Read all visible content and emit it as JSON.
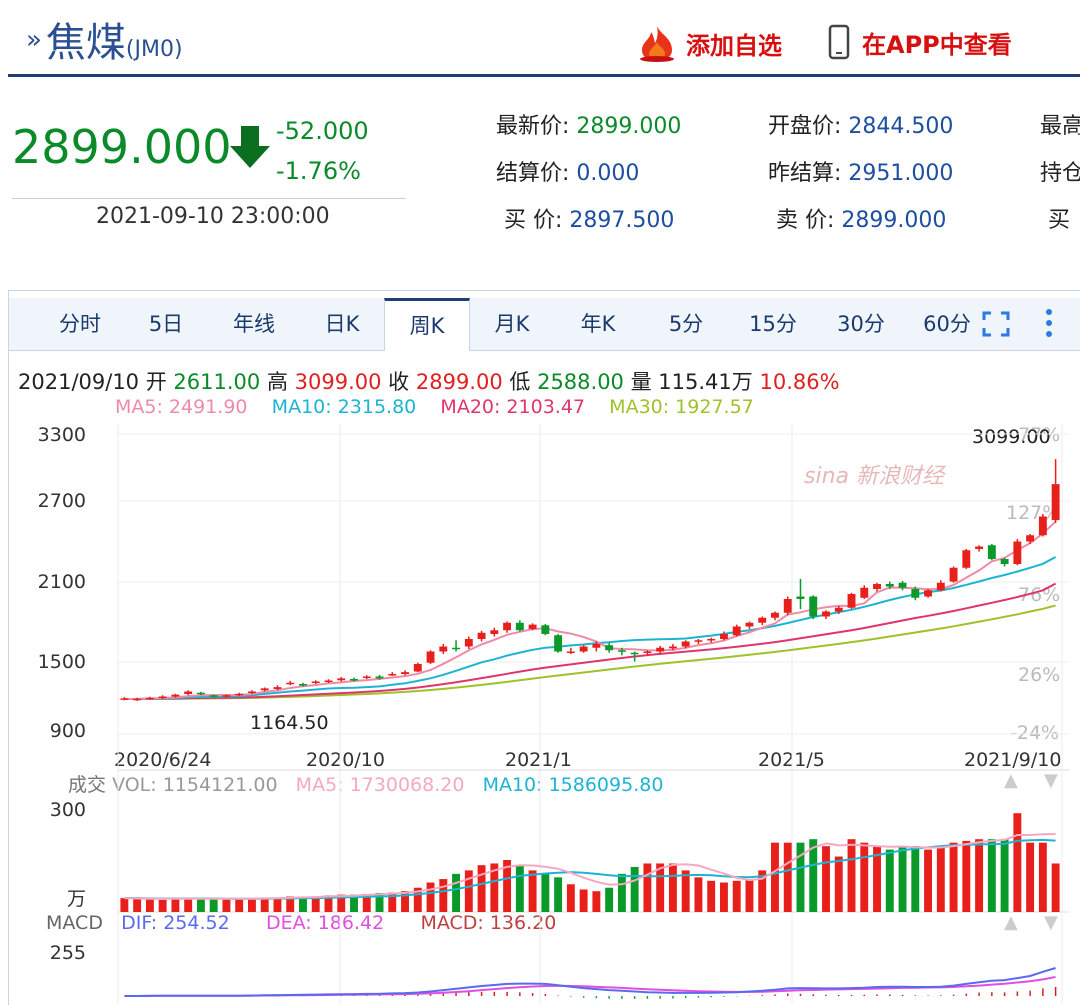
{
  "header": {
    "title": "焦煤",
    "code": "(JM0)",
    "add_watch": "添加自选",
    "view_app": "在APP中查看"
  },
  "quote": {
    "price": "2899.000",
    "change": "-52.000",
    "change_pct": "-1.76%",
    "time": "2021-09-10 23:00:00",
    "fields": {
      "latest_label": "最新价:",
      "latest": "2899.000",
      "open_label": "开盘价:",
      "open": "2844.500",
      "high_label": "最高",
      "settle_label": "结算价:",
      "settle": "0.000",
      "prev_settle_label": "昨结算:",
      "prev_settle": "2951.000",
      "oi_label": "持仓",
      "bid_label": "买  价:",
      "bid": "2897.500",
      "ask_label": "卖  价:",
      "ask": "2899.000",
      "bid2_label": "买"
    }
  },
  "tabs": [
    "分时",
    "5日",
    "年线",
    "日K",
    "周K",
    "月K",
    "年K",
    "5分",
    "15分",
    "30分",
    "60分"
  ],
  "active_tab": "周K",
  "kline_info": {
    "date": "2021/09/10",
    "open_label": "开",
    "open": "2611.00",
    "high_label": "高",
    "high": "3099.00",
    "close_label": "收",
    "close": "2899.00",
    "low_label": "低",
    "low": "2588.00",
    "vol_label": "量",
    "vol": "115.41万",
    "amp": "10.86%"
  },
  "ma": {
    "ma5": "MA5: 2491.90",
    "ma10": "MA10: 2315.80",
    "ma20": "MA20: 2103.47",
    "ma30": "MA30: 1927.57",
    "ma5_color": "#f08aa8",
    "ma10_color": "#1db4d4",
    "ma20_color": "#e0356c",
    "ma30_color": "#9ec22a"
  },
  "volume": {
    "label": "成交",
    "vol": "VOL: 1154121.00",
    "ma5": "MA5: 1730068.20",
    "ma10": "MA10: 1586095.80",
    "ytick": "300",
    "unit": "万"
  },
  "macd": {
    "label": "MACD",
    "dif": "DIF: 254.52",
    "dea": "DEA: 186.42",
    "macd": "MACD: 136.20",
    "ytick": "255"
  },
  "watermark": "sina 新浪财经",
  "chart_data": {
    "type": "candlestick",
    "y_ticks": [
      "3300",
      "2700",
      "2100",
      "1500",
      "900"
    ],
    "ylim": [
      900,
      3300
    ],
    "x_ticks": [
      "2020/6/24",
      "2020/10",
      "2021/1",
      "2021/5",
      "2021/9/10"
    ],
    "pct_ticks": [
      "77%",
      "127%",
      "76%",
      "26%",
      "-24%"
    ],
    "max_label": "3099.00",
    "min_label": "1164.50",
    "candles": [
      [
        1180,
        1185,
        1170,
        1195
      ],
      [
        1178,
        1182,
        1165,
        1190
      ],
      [
        1182,
        1190,
        1175,
        1198
      ],
      [
        1188,
        1200,
        1180,
        1210
      ],
      [
        1200,
        1215,
        1192,
        1222
      ],
      [
        1220,
        1240,
        1210,
        1250
      ],
      [
        1230,
        1218,
        1212,
        1238
      ],
      [
        1210,
        1198,
        1190,
        1215
      ],
      [
        1200,
        1210,
        1192,
        1216
      ],
      [
        1210,
        1222,
        1204,
        1230
      ],
      [
        1228,
        1240,
        1220,
        1250
      ],
      [
        1250,
        1265,
        1240,
        1272
      ],
      [
        1260,
        1275,
        1250,
        1290
      ],
      [
        1300,
        1310,
        1290,
        1325
      ],
      [
        1300,
        1290,
        1280,
        1310
      ],
      [
        1310,
        1320,
        1300,
        1330
      ],
      [
        1318,
        1328,
        1308,
        1338
      ],
      [
        1330,
        1345,
        1320,
        1355
      ],
      [
        1340,
        1330,
        1320,
        1352
      ],
      [
        1355,
        1360,
        1340,
        1370
      ],
      [
        1360,
        1345,
        1335,
        1372
      ],
      [
        1380,
        1380,
        1365,
        1395
      ],
      [
        1380,
        1395,
        1370,
        1410
      ],
      [
        1400,
        1460,
        1395,
        1470
      ],
      [
        1470,
        1560,
        1460,
        1570
      ],
      [
        1560,
        1600,
        1540,
        1620
      ],
      [
        1590,
        1580,
        1560,
        1650
      ],
      [
        1600,
        1660,
        1580,
        1680
      ],
      [
        1660,
        1710,
        1640,
        1725
      ],
      [
        1700,
        1730,
        1680,
        1750
      ],
      [
        1730,
        1790,
        1710,
        1800
      ],
      [
        1790,
        1730,
        1720,
        1810
      ],
      [
        1740,
        1775,
        1730,
        1785
      ],
      [
        1770,
        1700,
        1690,
        1780
      ],
      [
        1690,
        1560,
        1550,
        1700
      ],
      [
        1560,
        1560,
        1540,
        1590
      ],
      [
        1560,
        1600,
        1550,
        1610
      ],
      [
        1590,
        1620,
        1560,
        1640
      ],
      [
        1610,
        1570,
        1550,
        1630
      ],
      [
        1570,
        1560,
        1530,
        1590
      ],
      [
        1550,
        1545,
        1480,
        1560
      ],
      [
        1550,
        1560,
        1530,
        1570
      ],
      [
        1560,
        1590,
        1540,
        1605
      ],
      [
        1585,
        1600,
        1570,
        1620
      ],
      [
        1600,
        1640,
        1585,
        1650
      ],
      [
        1640,
        1650,
        1620,
        1660
      ],
      [
        1650,
        1660,
        1630,
        1670
      ],
      [
        1660,
        1700,
        1650,
        1720
      ],
      [
        1690,
        1760,
        1680,
        1775
      ],
      [
        1760,
        1790,
        1740,
        1800
      ],
      [
        1790,
        1830,
        1770,
        1840
      ],
      [
        1830,
        1870,
        1810,
        1880
      ],
      [
        1870,
        1980,
        1850,
        2000
      ],
      [
        2000,
        1980,
        1900,
        2140
      ],
      [
        2000,
        1840,
        1820,
        2010
      ],
      [
        1840,
        1880,
        1820,
        1890
      ],
      [
        1880,
        1910,
        1860,
        1925
      ],
      [
        1910,
        2020,
        1900,
        2030
      ],
      [
        1990,
        2070,
        1980,
        2090
      ],
      [
        2060,
        2100,
        2040,
        2110
      ],
      [
        2100,
        2080,
        2060,
        2120
      ],
      [
        2110,
        2070,
        2050,
        2125
      ],
      [
        2060,
        1990,
        1970,
        2080
      ],
      [
        2000,
        2050,
        1990,
        2060
      ],
      [
        2050,
        2110,
        2040,
        2130
      ],
      [
        2120,
        2230,
        2110,
        2240
      ],
      [
        2230,
        2370,
        2220,
        2380
      ],
      [
        2380,
        2400,
        2360,
        2410
      ],
      [
        2410,
        2300,
        2290,
        2420
      ],
      [
        2300,
        2260,
        2240,
        2310
      ],
      [
        2260,
        2440,
        2250,
        2460
      ],
      [
        2440,
        2490,
        2420,
        2500
      ],
      [
        2490,
        2640,
        2480,
        2660
      ],
      [
        2611,
        2899,
        2588,
        3099
      ]
    ],
    "ma5": [
      1180,
      1181,
      1184,
      1188,
      1193,
      1203,
      1210,
      1211,
      1212,
      1212,
      1220,
      1237,
      1249,
      1268,
      1282,
      1292,
      1305,
      1313,
      1324,
      1331,
      1341,
      1352,
      1363,
      1382,
      1412,
      1462,
      1514,
      1569,
      1617,
      1654,
      1694,
      1718,
      1739,
      1746,
      1720,
      1703,
      1676,
      1639,
      1586,
      1580,
      1578,
      1570,
      1569,
      1573,
      1590,
      1611,
      1626,
      1648,
      1684,
      1714,
      1750,
      1785,
      1856,
      1874,
      1898,
      1914,
      1926,
      1924,
      1946,
      2034,
      2072,
      2070,
      2066,
      2058,
      2060,
      2092,
      2151,
      2209,
      2281,
      2310,
      2371,
      2427,
      2504,
      2600
    ],
    "ma10": [
      1180,
      1180,
      1182,
      1184,
      1187,
      1193,
      1196,
      1198,
      1200,
      1202,
      1210,
      1221,
      1230,
      1240,
      1247,
      1256,
      1264,
      1268,
      1270,
      1275,
      1281,
      1294,
      1306,
      1325,
      1346,
      1374,
      1406,
      1439,
      1474,
      1498,
      1527,
      1551,
      1574,
      1590,
      1598,
      1609,
      1616,
      1627,
      1634,
      1644,
      1651,
      1655,
      1658,
      1660,
      1664,
      1676,
      1687,
      1701,
      1717,
      1730,
      1746,
      1765,
      1788,
      1812,
      1836,
      1855,
      1875,
      1894,
      1918,
      1944,
      1972,
      1996,
      2017,
      2035,
      2048,
      2068,
      2094,
      2120,
      2148,
      2172,
      2200,
      2230,
      2262,
      2316
    ],
    "ma20": [
      1180,
      1180,
      1181,
      1182,
      1183,
      1186,
      1188,
      1189,
      1190,
      1191,
      1194,
      1198,
      1202,
      1207,
      1212,
      1217,
      1222,
      1227,
      1232,
      1238,
      1244,
      1252,
      1261,
      1272,
      1285,
      1299,
      1314,
      1330,
      1347,
      1364,
      1382,
      1399,
      1416,
      1431,
      1444,
      1457,
      1470,
      1483,
      1496,
      1508,
      1520,
      1531,
      1541,
      1550,
      1559,
      1568,
      1577,
      1587,
      1598,
      1610,
      1622,
      1635,
      1650,
      1666,
      1682,
      1698,
      1714,
      1730,
      1748,
      1768,
      1788,
      1808,
      1828,
      1846,
      1864,
      1884,
      1906,
      1928,
      1950,
      1972,
      1996,
      2022,
      2050,
      2103
    ],
    "ma30": [
      1180,
      1180,
      1181,
      1181,
      1182,
      1183,
      1184,
      1185,
      1186,
      1187,
      1189,
      1191,
      1194,
      1197,
      1200,
      1204,
      1208,
      1212,
      1216,
      1220,
      1225,
      1231,
      1237,
      1244,
      1252,
      1261,
      1271,
      1282,
      1293,
      1305,
      1317,
      1330,
      1343,
      1356,
      1368,
      1380,
      1392,
      1404,
      1416,
      1428,
      1440,
      1451,
      1462,
      1472,
      1482,
      1492,
      1502,
      1512,
      1523,
      1534,
      1545,
      1557,
      1569,
      1582,
      1595,
      1608,
      1621,
      1635,
      1649,
      1664,
      1680,
      1696,
      1712,
      1728,
      1744,
      1762,
      1780,
      1799,
      1818,
      1838,
      1858,
      1880,
      1902,
      1928
    ],
    "volume": {
      "ylim": [
        0,
        300
      ],
      "values": [
        40,
        38,
        36,
        35,
        38,
        40,
        38,
        36,
        38,
        40,
        38,
        42,
        40,
        45,
        43,
        45,
        48,
        50,
        50,
        52,
        55,
        56,
        60,
        70,
        85,
        95,
        110,
        120,
        135,
        140,
        150,
        135,
        120,
        110,
        100,
        80,
        65,
        60,
        70,
        110,
        130,
        140,
        140,
        140,
        120,
        100,
        90,
        85,
        90,
        95,
        120,
        200,
        200,
        200,
        210,
        190,
        160,
        210,
        200,
        190,
        180,
        190,
        190,
        180,
        190,
        200,
        205,
        210,
        210,
        210,
        285,
        200,
        200,
        140
      ],
      "ma5": [
        40,
        39,
        38,
        38,
        38,
        38,
        38,
        38,
        38,
        38,
        38,
        39,
        40,
        41,
        42,
        43,
        45,
        46,
        47,
        49,
        51,
        53,
        55,
        59,
        65,
        73,
        84,
        96,
        108,
        120,
        130,
        135,
        134,
        130,
        125,
        113,
        99,
        87,
        79,
        80,
        91,
        108,
        126,
        136,
        138,
        134,
        122,
        111,
        99,
        92,
        96,
        118,
        141,
        163,
        186,
        198,
        192,
        194,
        192,
        190,
        188,
        189,
        187,
        186,
        186,
        190,
        196,
        201,
        205,
        208,
        222,
        222,
        224,
        225
      ],
      "ma10": [
        40,
        40,
        39,
        39,
        39,
        39,
        39,
        39,
        38,
        38,
        38,
        38,
        39,
        39,
        40,
        40,
        41,
        42,
        43,
        44,
        45,
        46,
        48,
        51,
        55,
        60,
        66,
        73,
        81,
        89,
        97,
        104,
        108,
        111,
        113,
        115,
        113,
        110,
        106,
        103,
        104,
        103,
        103,
        104,
        106,
        107,
        106,
        103,
        101,
        100,
        103,
        111,
        120,
        128,
        136,
        143,
        147,
        152,
        158,
        164,
        171,
        178,
        183,
        187,
        190,
        193,
        194,
        195,
        196,
        197,
        205,
        207,
        208,
        206
      ]
    },
    "macd": {
      "dif": [
        0,
        0,
        1,
        1,
        2,
        2,
        2,
        2,
        2,
        2,
        3,
        4,
        5,
        6,
        7,
        8,
        9,
        10,
        11,
        12,
        13,
        15,
        17,
        20,
        26,
        34,
        42,
        50,
        58,
        64,
        70,
        72,
        72,
        70,
        62,
        54,
        46,
        40,
        34,
        30,
        26,
        22,
        20,
        18,
        18,
        18,
        19,
        20,
        22,
        26,
        30,
        36,
        44,
        46,
        45,
        44,
        44,
        46,
        48,
        52,
        54,
        54,
        52,
        52,
        54,
        60,
        70,
        80,
        88,
        92,
        104,
        116,
        140,
        162
      ],
      "dea": [
        0,
        0,
        0,
        1,
        1,
        1,
        1,
        2,
        2,
        2,
        2,
        3,
        3,
        4,
        4,
        5,
        6,
        7,
        7,
        8,
        9,
        10,
        11,
        13,
        15,
        19,
        23,
        28,
        34,
        40,
        46,
        51,
        55,
        58,
        59,
        58,
        56,
        53,
        50,
        47,
        43,
        39,
        36,
        33,
        30,
        28,
        26,
        25,
        24,
        24,
        25,
        27,
        30,
        33,
        35,
        37,
        38,
        40,
        41,
        43,
        45,
        47,
        48,
        49,
        50,
        52,
        56,
        60,
        66,
        71,
        78,
        85,
        96,
        110
      ],
      "hist": [
        0,
        0,
        1,
        0,
        1,
        1,
        1,
        0,
        0,
        0,
        1,
        1,
        2,
        2,
        3,
        3,
        3,
        3,
        4,
        4,
        4,
        5,
        6,
        7,
        11,
        15,
        19,
        22,
        24,
        24,
        24,
        21,
        17,
        12,
        3,
        -4,
        -10,
        -13,
        -16,
        -17,
        -17,
        -17,
        -16,
        -15,
        -12,
        -10,
        -7,
        -5,
        -2,
        2,
        5,
        9,
        14,
        13,
        10,
        7,
        6,
        6,
        7,
        9,
        9,
        7,
        4,
        3,
        4,
        8,
        14,
        20,
        22,
        21,
        26,
        31,
        44,
        52
      ],
      "ylim": [
        -120,
        255
      ]
    }
  }
}
